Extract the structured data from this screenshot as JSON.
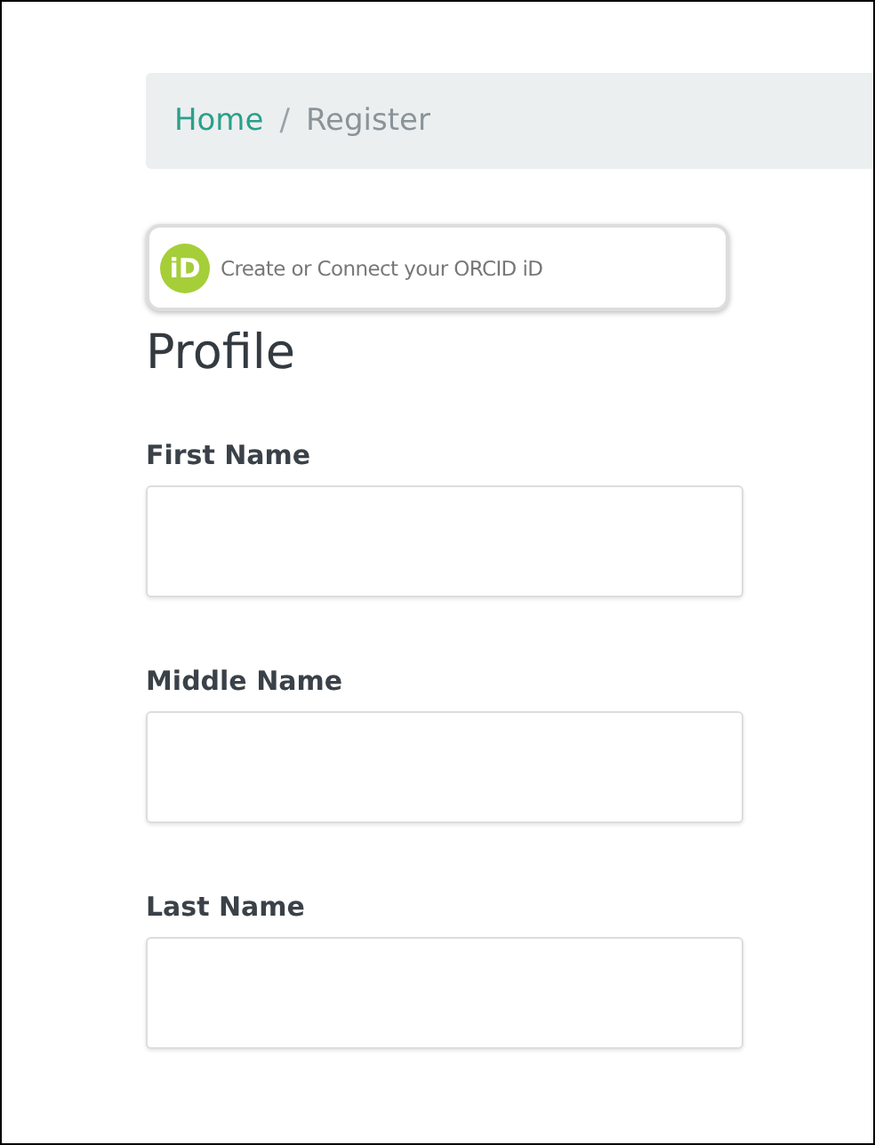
{
  "breadcrumb": [
    {
      "label": "Home",
      "selected": false
    },
    {
      "label": "Register",
      "selected": true
    }
  ],
  "breadcrumb_separator": "/",
  "orcid_button": {
    "logo_text": "iD",
    "label": "Create or Connect your ORCID iD"
  },
  "heading": "Profile",
  "fields": [
    {
      "label": "First Name"
    },
    {
      "label": "Middle Name"
    },
    {
      "label": "Last Name"
    }
  ]
}
